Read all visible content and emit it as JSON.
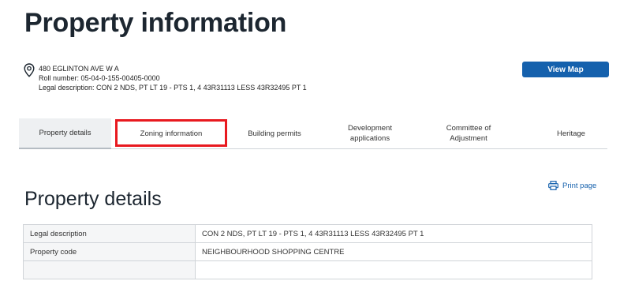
{
  "page": {
    "title": "Property information",
    "address": "480 EGLINTON AVE W A",
    "roll_number": "Roll number: 05-04-0-155-00405-0000",
    "legal_description_line": "Legal description: CON 2 NDS, PT LT 19 - PTS 1, 4 43R31113 LESS 43R32495 PT 1",
    "view_map_label": "View Map"
  },
  "tabs": [
    {
      "label": "Property details",
      "active": true
    },
    {
      "label": "Zoning information",
      "active": false
    },
    {
      "label": "Building permits",
      "active": false
    },
    {
      "label": "Development applications",
      "active": false
    },
    {
      "label": "Committee of Adjustment",
      "active": false
    },
    {
      "label": "Heritage",
      "active": false
    }
  ],
  "print_label": "Print page",
  "section": {
    "title": "Property details",
    "rows": [
      {
        "label": "Legal description",
        "value": "CON 2 NDS, PT LT 19 - PTS 1, 4 43R31113 LESS 43R32495 PT 1"
      },
      {
        "label": "Property code",
        "value": "NEIGHBOURHOOD SHOPPING CENTRE"
      }
    ]
  },
  "colors": {
    "primary": "#1561ad",
    "highlight": "#e8191f",
    "title": "#1c2630"
  },
  "icons": {
    "location": "location-pin-icon",
    "print": "printer-icon"
  }
}
